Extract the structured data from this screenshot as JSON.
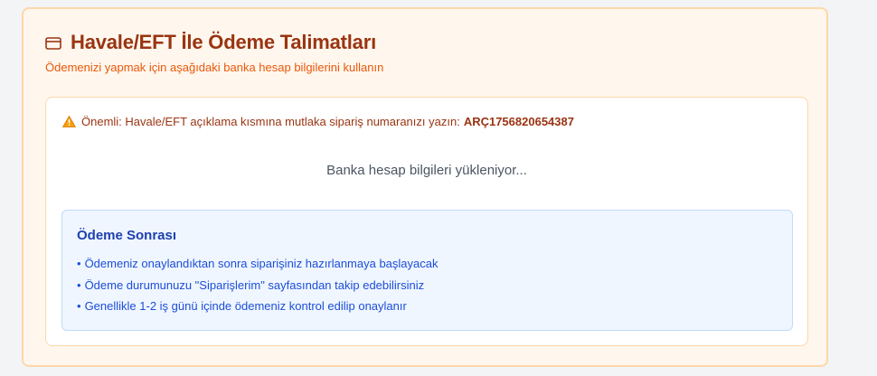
{
  "header": {
    "icon": "credit-card-icon",
    "title": "Havale/EFT İle Ödeme Talimatları",
    "subtitle": "Ödemenizi yapmak için aşağıdaki banka hesap bilgilerini kullanın"
  },
  "warning": {
    "icon": "warning-icon",
    "text": "Önemli: Havale/EFT açıklama kısmına mutlaka sipariş numaranızı yazın:",
    "order_number": "ARÇ1756820654387"
  },
  "loading_text": "Banka hesap bilgileri yükleniyor...",
  "after_payment": {
    "title": "Ödeme Sonrası",
    "bullet": "•",
    "items": [
      "Ödemeniz onaylandıktan sonra siparişiniz hazırlanmaya başlayacak",
      "Ödeme durumunuzu \"Siparişlerim\" sayfasından takip edebilirsiniz",
      "Genellikle 1-2 iş günü içinde ödemeniz kontrol edilip onaylanır"
    ]
  },
  "colors": {
    "card_bg": "#fff7ed",
    "card_border": "#fed7aa",
    "title": "#9a3412",
    "subtitle": "#ea580c",
    "info_bg": "#eff6ff",
    "info_text": "#1d4ed8"
  }
}
